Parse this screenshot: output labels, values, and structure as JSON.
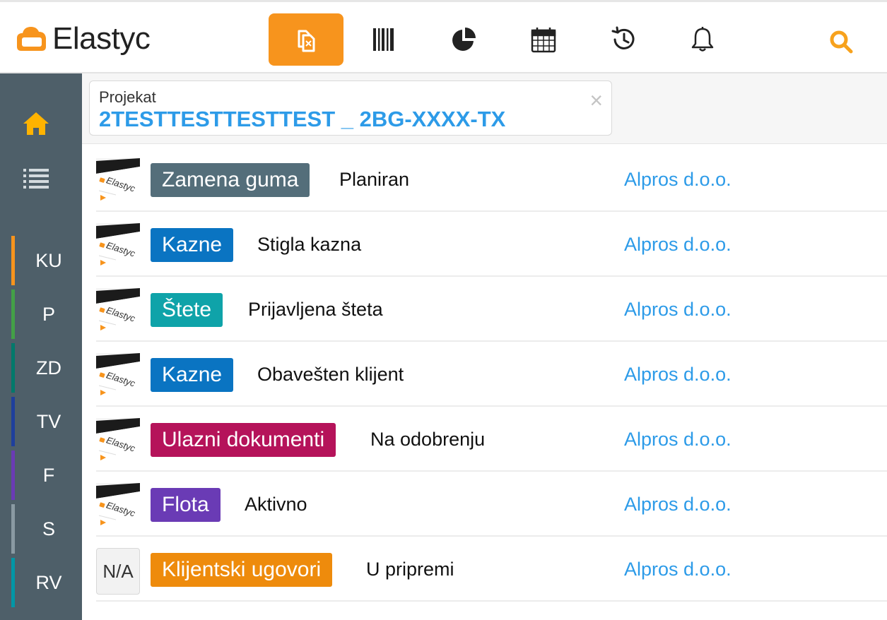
{
  "app": {
    "logo_text": "Elastyc",
    "brand_color": "#f7941d",
    "link_color": "#2d9be8"
  },
  "topnav": {
    "items": [
      {
        "name": "documents-icon",
        "active": true
      },
      {
        "name": "barcode-icon",
        "active": false
      },
      {
        "name": "pie-chart-icon",
        "active": false
      },
      {
        "name": "calendar-icon",
        "active": false
      },
      {
        "name": "history-icon",
        "active": false
      },
      {
        "name": "bell-icon",
        "active": false
      }
    ],
    "search_icon": "search-icon"
  },
  "sidebar": {
    "icons": [
      "home-icon",
      "list-icon"
    ],
    "items": [
      {
        "label": "KU",
        "color": "#f7941d"
      },
      {
        "label": "P",
        "color": "#43a047"
      },
      {
        "label": "ZD",
        "color": "#00796b"
      },
      {
        "label": "TV",
        "color": "#1f3f9c"
      },
      {
        "label": "F",
        "color": "#6a3bb5"
      },
      {
        "label": "S",
        "color": "#8a9aa3"
      },
      {
        "label": "RV",
        "color": "#0097a7"
      }
    ]
  },
  "filter": {
    "label": "Projekat",
    "value": "2TESTTESTTESTTEST _ 2BG-XXXX-TX",
    "close_icon": "close-icon"
  },
  "rows": [
    {
      "thumb": "image",
      "badge": "Zamena guma",
      "badge_color": "#546e7a",
      "status": "Planiran",
      "company": "Alpros d.o.o."
    },
    {
      "thumb": "image",
      "badge": "Kazne",
      "badge_color": "#0a74c2",
      "status": "Stigla kazna",
      "company": "Alpros d.o.o."
    },
    {
      "thumb": "image",
      "badge": "Štete",
      "badge_color": "#0fa3a9",
      "status": "Prijavljena šteta",
      "company": "Alpros d.o.o."
    },
    {
      "thumb": "image",
      "badge": "Kazne",
      "badge_color": "#0a74c2",
      "status": "Obavešten klijent",
      "company": "Alpros d.o.o."
    },
    {
      "thumb": "image",
      "badge": "Ulazni dokumenti",
      "badge_color": "#b5135a",
      "status": "Na odobrenju",
      "company": "Alpros d.o.o."
    },
    {
      "thumb": "image",
      "badge": "Flota",
      "badge_color": "#6a3bb5",
      "status": "Aktivno",
      "company": "Alpros d.o.o."
    },
    {
      "thumb": "N/A",
      "badge": "Klijentski ugovori",
      "badge_color": "#ee8b0c",
      "status": "U pripremi",
      "company": "Alpros d.o.o."
    }
  ]
}
